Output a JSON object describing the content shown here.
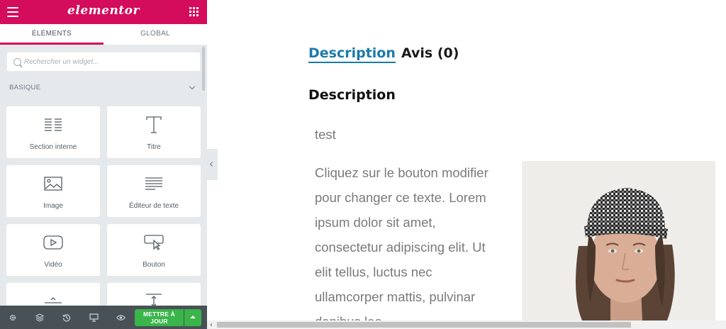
{
  "panel": {
    "logo": "elementor",
    "tabs": [
      {
        "label": "ÉLÉMENTS",
        "active": true
      },
      {
        "label": "GLOBAL",
        "active": false
      }
    ],
    "search": {
      "placeholder": "Rechercher un widget..."
    },
    "category": "BASIQUE",
    "widgets": [
      {
        "label": "Section interne",
        "icon": "columns-icon"
      },
      {
        "label": "Titre",
        "icon": "heading-icon"
      },
      {
        "label": "Image",
        "icon": "image-icon"
      },
      {
        "label": "Éditeur de texte",
        "icon": "text-editor-icon"
      },
      {
        "label": "Vidéo",
        "icon": "video-icon"
      },
      {
        "label": "Bouton",
        "icon": "button-icon"
      },
      {
        "label": "",
        "icon": "divider-icon"
      },
      {
        "label": "",
        "icon": "spacer-icon"
      }
    ],
    "footer": {
      "icons": [
        "settings-icon",
        "navigator-icon",
        "history-icon",
        "responsive-icon",
        "preview-icon"
      ],
      "update_label_line1": "METTRE À",
      "update_label_line2": "JOUR"
    },
    "colors": {
      "brand": "#d30c5c",
      "update": "#39b54a"
    }
  },
  "preview": {
    "tabs": [
      {
        "label": "Description",
        "active": true
      },
      {
        "label": "Avis (0)",
        "active": false
      }
    ],
    "heading": "Description",
    "short_text": "test",
    "lines": [
      "Cliquez sur le bouton modifier",
      "pour changer ce texte. Lorem",
      "ipsum dolor sit amet,",
      "consectetur adipiscing elit. Ut",
      "elit tellus, luctus nec",
      "ullamcorper mattis, pulvinar",
      "dapibus leo."
    ],
    "accent": "#1b7aaa"
  }
}
